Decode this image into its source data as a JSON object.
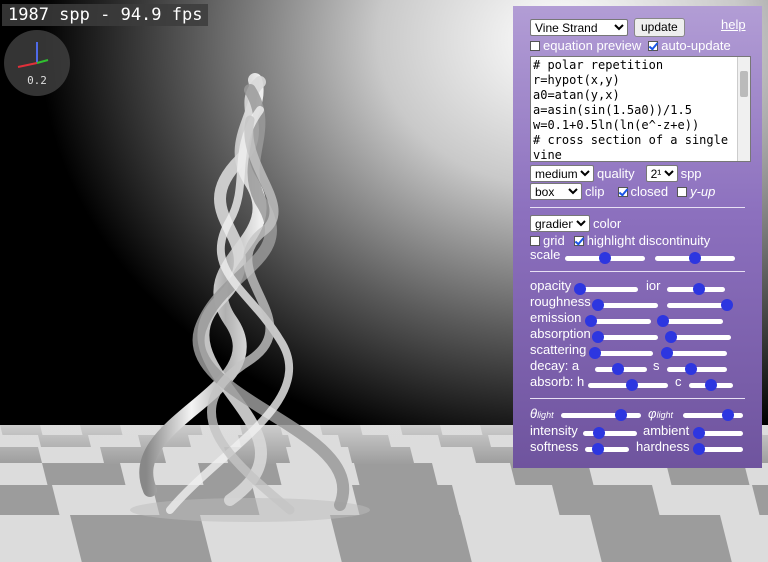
{
  "status": {
    "fps_text": "1987 spp - 94.9 fps",
    "axes_scale": "0.2"
  },
  "panel": {
    "preset": "Vine Strand",
    "update_label": "update",
    "help_label": "help",
    "equation_preview": {
      "label": "equation preview",
      "checked": false
    },
    "auto_update": {
      "label": "auto-update",
      "checked": true
    },
    "equation_text": "# polar repetition\nr=hypot(x,y)\na0=atan(y,x)\na=asin(sin(1.5a0))/1.5\nw=0.1+0.5ln(ln(e^-z+e))\n# cross section of a single vine",
    "quality": {
      "value": "medium",
      "label": "quality"
    },
    "spp": {
      "value": "2¹²",
      "label": "spp"
    },
    "clip": {
      "value": "box",
      "label": "clip"
    },
    "closed": {
      "label": "closed",
      "checked": true
    },
    "y_up": {
      "label": "y-up",
      "checked": false
    },
    "color": {
      "value": "gradient",
      "label": "color"
    },
    "grid": {
      "label": "grid",
      "checked": false
    },
    "highlight": {
      "label": "highlight discontinuity",
      "checked": true
    },
    "scale_label": "scale",
    "sliders": {
      "opacity": {
        "label": "opacity",
        "value": 0.0
      },
      "ior": {
        "label": "ior",
        "value": 0.55
      },
      "roughness": {
        "label": "roughness",
        "value": 0.0
      },
      "roughness2": {
        "value": 1.0
      },
      "emission": {
        "label": "emission",
        "value": 0.0
      },
      "emission2": {
        "value": 0.0
      },
      "absorption": {
        "label": "absorption",
        "value": 0.0
      },
      "absorption2": {
        "value": 0.0
      },
      "scattering": {
        "label": "scattering",
        "value": 0.0
      },
      "scattering2": {
        "value": 0.0
      },
      "decay_a": {
        "label": "decay: a",
        "value": 0.45
      },
      "decay_s": {
        "label": "s",
        "value": 0.4
      },
      "absorb_h": {
        "label": "absorb: h",
        "value": 0.55
      },
      "absorb_c": {
        "label": "c",
        "value": 0.5
      },
      "scale1": {
        "value": 0.5
      },
      "scale2": {
        "value": 0.5
      },
      "theta": {
        "label_main": "θ",
        "label_sub": "light",
        "value": 0.75
      },
      "phi": {
        "label_main": "φ",
        "label_sub": "light",
        "value": 0.75
      },
      "intensity": {
        "label": "intensity",
        "value": 0.3
      },
      "ambient": {
        "label": "ambient",
        "value": 0.0
      },
      "softness": {
        "label": "softness",
        "value": 0.3
      },
      "hardness": {
        "label": "hardness",
        "value": 0.0
      }
    }
  }
}
